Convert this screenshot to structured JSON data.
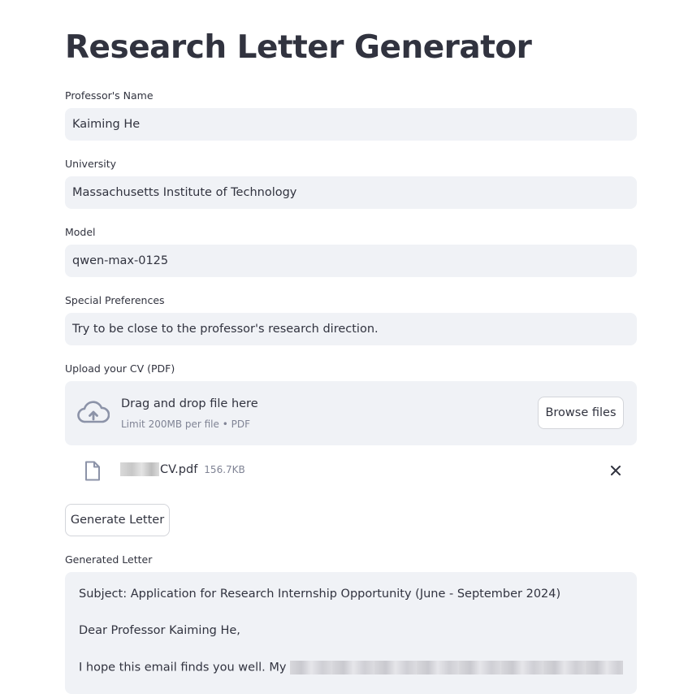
{
  "app": {
    "title": "Research Letter Generator"
  },
  "form": {
    "professor": {
      "label": "Professor's Name",
      "value": "Kaiming He"
    },
    "university": {
      "label": "University",
      "value": "Massachusetts Institute of Technology"
    },
    "model": {
      "label": "Model",
      "value": "qwen-max-0125"
    },
    "preferences": {
      "label": "Special Preferences",
      "value": "Try to be close to the professor's research direction."
    },
    "upload": {
      "label": "Upload your CV (PDF)",
      "dropzone_title": "Drag and drop file here",
      "dropzone_limit": "Limit 200MB per file • PDF",
      "browse_label": "Browse files",
      "icon": "cloud-upload-icon"
    },
    "file": {
      "name_suffix": "CV.pdf",
      "size": "156.7KB",
      "icon": "file-icon",
      "remove_icon": "close-icon"
    }
  },
  "actions": {
    "generate_label": "Generate Letter"
  },
  "output": {
    "label": "Generated Letter",
    "lines": [
      "Subject: Application for Research Internship Opportunity (June - September 2024)",
      "Dear Professor Kaiming He,",
      "I hope this email finds you well. My "
    ]
  },
  "colors": {
    "text": "#31333f",
    "field_bg": "#f0f2f6",
    "muted": "#808495",
    "border": "#d3d5da",
    "icon": "#8c93a8"
  }
}
